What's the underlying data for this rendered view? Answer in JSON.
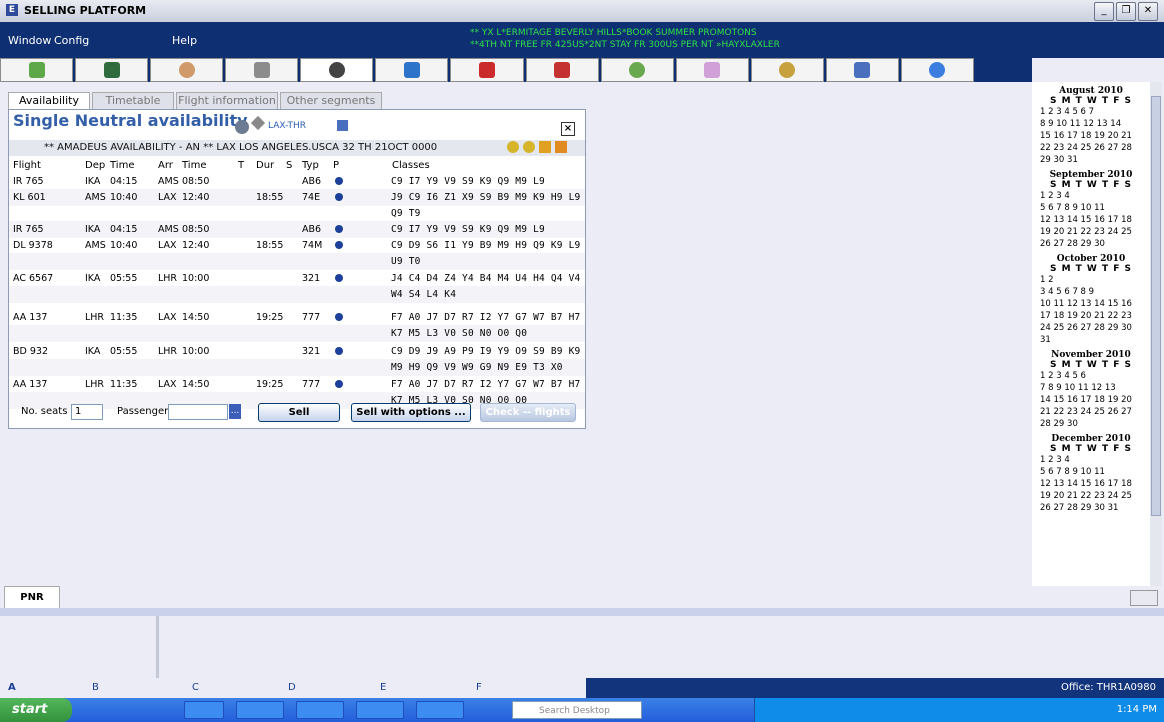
{
  "window": {
    "title": "SELLING PLATFORM",
    "app_icon": "E",
    "controls": [
      "_",
      "❐",
      "✕"
    ]
  },
  "menu": {
    "items": [
      "Window",
      "Config",
      "Help"
    ]
  },
  "promo": [
    "** YX L*ERMITAGE BEVERLY HILLS*BOOK SUMMER PROMOTONS",
    "**4TH NT FREE FR 425US*2NT STAY FR 300US PER NT »HAYXLAXLER"
  ],
  "toolbar_icons": [
    "cube-icon",
    "terminal-icon",
    "agent-icon",
    "hotel-icon",
    "flight-icon",
    "car-icon",
    "porter-icon",
    "luggage-icon",
    "rail-icon",
    "ticket-icon",
    "person-icon",
    "document-icon",
    "info-icon"
  ],
  "tabs": [
    "Availability",
    "Timetable",
    "Flight information",
    "Other segments"
  ],
  "panel": {
    "title": "Single Neutral availability",
    "route": "LAX-THR",
    "header_line": "** AMADEUS AVAILABILITY - AN ** LAX LOS ANGELES.USCA    32 TH 21OCT 0000",
    "columns": [
      "Flight",
      "Dep",
      "Time",
      "Arr",
      "Time",
      "T",
      "Dur",
      "S",
      "Typ",
      "P",
      "Classes"
    ],
    "rows": [
      {
        "flight": "IR 765",
        "dep": "IKA",
        "dtime": "04:15",
        "arr": "AMS",
        "atime": "08:50",
        "dur": "",
        "typ": "AB6",
        "classes": "C9 I7 Y9 V9 S9 K9 Q9 M9 L9"
      },
      {
        "flight": "KL 601",
        "dep": "AMS",
        "dtime": "10:40",
        "arr": "LAX",
        "atime": "12:40",
        "dur": "18:55",
        "typ": "74E",
        "classes": "J9 C9 I6 Z1 X9 S9 B9 M9 K9 H9 L9"
      },
      {
        "flight": "",
        "dep": "",
        "dtime": "",
        "arr": "",
        "atime": "",
        "dur": "",
        "typ": "",
        "classes": "Q9 T9"
      },
      {
        "flight": "IR 765",
        "dep": "IKA",
        "dtime": "04:15",
        "arr": "AMS",
        "atime": "08:50",
        "dur": "",
        "typ": "AB6",
        "classes": "C9 I7 Y9 V9 S9 K9 Q9 M9 L9"
      },
      {
        "flight": "DL 9378",
        "dep": "AMS",
        "dtime": "10:40",
        "arr": "LAX",
        "atime": "12:40",
        "dur": "18:55",
        "typ": "74M",
        "classes": "C9 D9 S6 I1 Y9 B9 M9 H9 Q9 K9 L9"
      },
      {
        "flight": "",
        "dep": "",
        "dtime": "",
        "arr": "",
        "atime": "",
        "dur": "",
        "typ": "",
        "classes": "U9 T0"
      },
      {
        "flight": "AC 6567",
        "dep": "IKA",
        "dtime": "05:55",
        "arr": "LHR",
        "atime": "10:00",
        "dur": "",
        "typ": "321",
        "classes": "J4 C4 D4 Z4 Y4 B4 M4 U4 H4 Q4 V4"
      },
      {
        "flight": "",
        "dep": "",
        "dtime": "",
        "arr": "",
        "atime": "",
        "dur": "",
        "typ": "",
        "classes": "W4 S4 L4 K4"
      },
      {
        "flight": "AA 137",
        "dep": "LHR",
        "dtime": "11:35",
        "arr": "LAX",
        "atime": "14:50",
        "dur": "19:25",
        "typ": "777",
        "classes": "F7 A0 J7 D7 R7 I2 Y7 G7 W7 B7 H7"
      },
      {
        "flight": "",
        "dep": "",
        "dtime": "",
        "arr": "",
        "atime": "",
        "dur": "",
        "typ": "",
        "classes": "K7 M5 L3 V0 S0 N0 O0 Q0"
      },
      {
        "flight": "BD 932",
        "dep": "IKA",
        "dtime": "05:55",
        "arr": "LHR",
        "atime": "10:00",
        "dur": "",
        "typ": "321",
        "classes": "C9 D9 J9 A9 P9 I9 Y9 O9 S9 B9 K9"
      },
      {
        "flight": "",
        "dep": "",
        "dtime": "",
        "arr": "",
        "atime": "",
        "dur": "",
        "typ": "",
        "classes": "M9 H9 Q9 V9 W9 G9 N9 E9 T3 X0"
      },
      {
        "flight": "AA 137",
        "dep": "LHR",
        "dtime": "11:35",
        "arr": "LAX",
        "atime": "14:50",
        "dur": "19:25",
        "typ": "777",
        "classes": "F7 A0 J7 D7 R7 I2 Y7 G7 W7 B7 H7"
      },
      {
        "flight": "",
        "dep": "",
        "dtime": "",
        "arr": "",
        "atime": "",
        "dur": "",
        "typ": "",
        "classes": "K7 M5 L3 V0 S0 N0 O0 Q0"
      }
    ],
    "no_seats_label": "No. seats",
    "no_seats_value": "1",
    "passenger_label": "Passenger",
    "passenger_value": "",
    "sell": "Sell",
    "sell_options": "Sell with options ...",
    "check_flights": "Check -- flights"
  },
  "calendar": [
    {
      "title": "August 2010",
      "days_header": "S M T W T F S",
      "lines": [
        "1 2 3 4 5 6 7",
        "8 9 10 11 12 13 14",
        "15 16 17 18 19 20 21",
        "22 23 24 25 26 27 28",
        "29 30 31"
      ]
    },
    {
      "title": "September 2010",
      "days_header": "S M T W T F S",
      "lines": [
        "1 2 3 4",
        "5 6 7 8 9 10 11",
        "12 13 14 15 16 17 18",
        "19 20 21 22 23 24 25",
        "26 27 28 29 30"
      ]
    },
    {
      "title": "October 2010",
      "days_header": "S M T W T F S",
      "lines": [
        "1 2",
        "3 4 5 6 7 8 9",
        "10 11 12 13 14 15 16",
        "17 18 19 20 21 22 23",
        "24 25 26 27 28 29 30",
        "31"
      ]
    },
    {
      "title": "November 2010",
      "days_header": "S M T W T F S",
      "lines": [
        "1 2 3 4 5 6",
        "7 8 9 10 11 12 13",
        "14 15 16 17 18 19 20",
        "21 22 23 24 25 26 27",
        "28 29 30"
      ]
    },
    {
      "title": "December 2010",
      "days_header": "S M T W T F S",
      "lines": [
        "1 2 3 4",
        "5 6 7 8 9 10 11",
        "12 13 14 15 16 17 18",
        "19 20 21 22 23 24 25",
        "26 27 28 29 30 31"
      ]
    }
  ],
  "pnr_tab": "PNR",
  "status": {
    "areas": [
      "A",
      "B",
      "C",
      "D",
      "E",
      "F"
    ],
    "office": "Office: THR1A0980"
  },
  "taskbar": {
    "start": "start",
    "search_placeholder": "Search Desktop",
    "time": "1:14 PM"
  }
}
